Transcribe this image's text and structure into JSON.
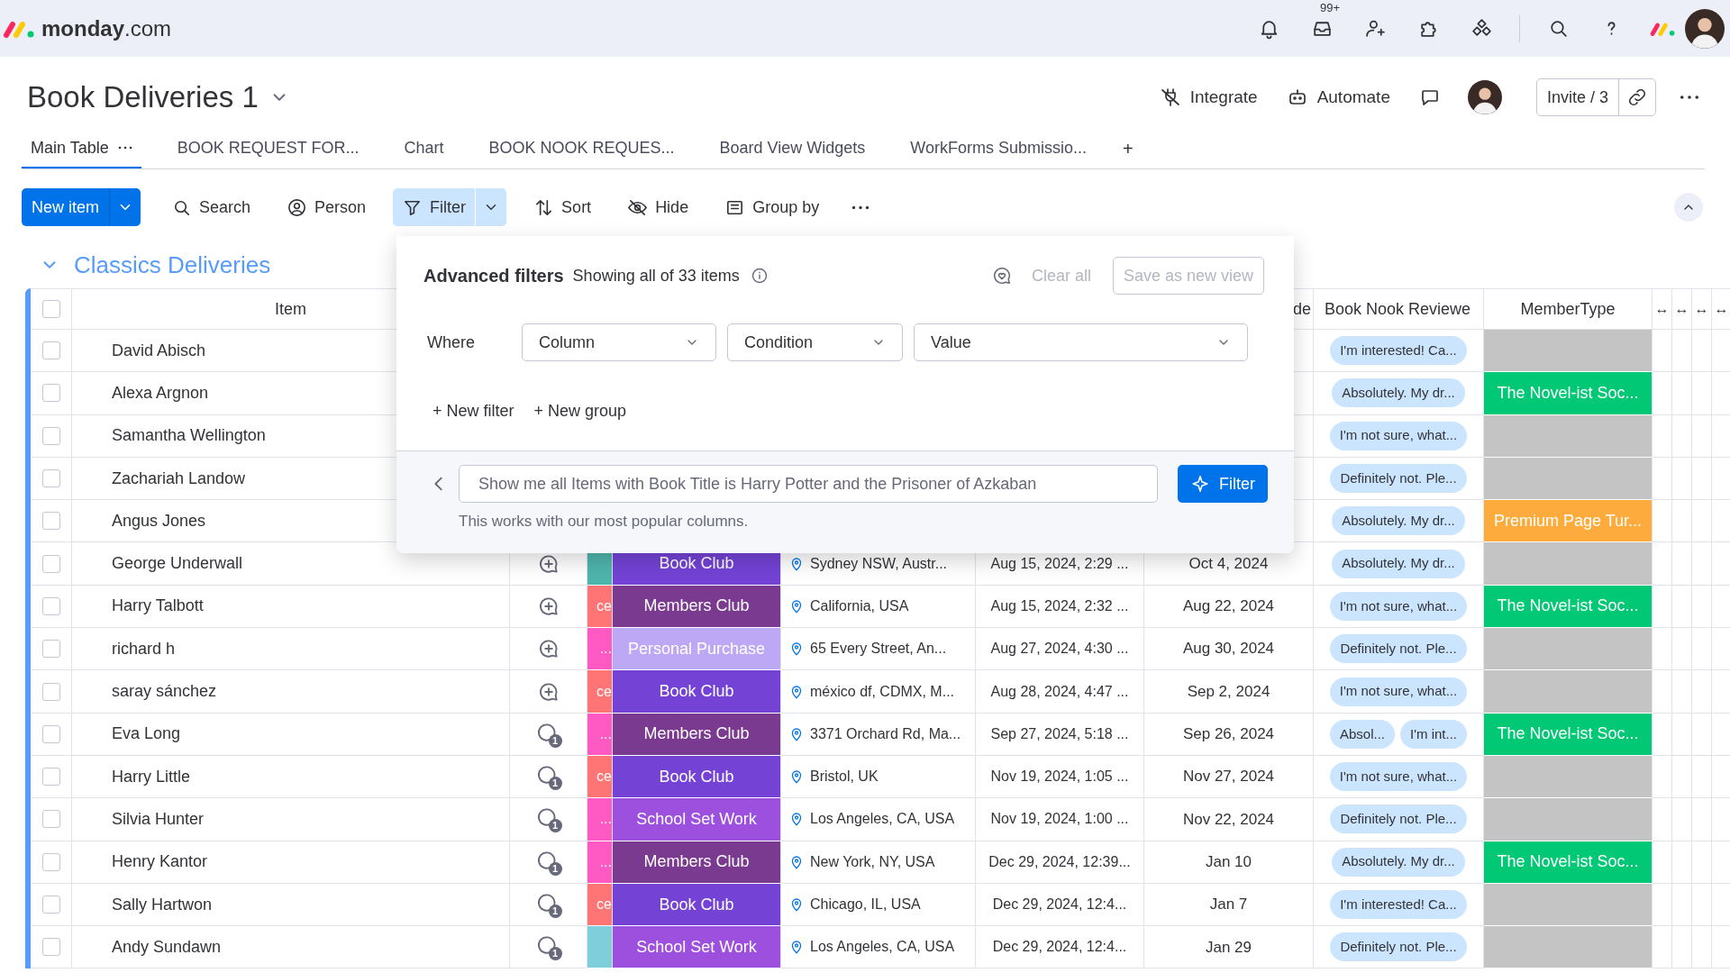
{
  "top_bar": {
    "logo": "**monday**.com",
    "inbox_badge": "99+"
  },
  "board": {
    "title": "Book Deliveries 1",
    "actions": [
      {
        "kind": "integrate",
        "label": "Integrate"
      },
      {
        "kind": "automate",
        "label": "Automate"
      }
    ],
    "invite": "Invite / 3"
  },
  "tabs": [
    {
      "label": "Main Table",
      "selected": true
    },
    {
      "label": "BOOK REQUEST FOR...",
      "selected": false
    },
    {
      "label": "Chart",
      "selected": false
    },
    {
      "label": "BOOK NOOK REQUES...",
      "selected": false
    },
    {
      "label": "Board View Widgets",
      "selected": false
    },
    {
      "label": "WorkForms Submissio...",
      "selected": false
    }
  ],
  "add_tab": "+",
  "toolbar": {
    "new_item": "New item",
    "tools": [
      {
        "kind": "search",
        "label": "Search",
        "selected": false
      },
      {
        "kind": "person",
        "label": "Person",
        "selected": false
      },
      {
        "kind": "filter",
        "label": "Filter",
        "selected": true
      },
      {
        "kind": "sort",
        "label": "Sort",
        "selected": false
      },
      {
        "kind": "hide",
        "label": "Hide",
        "selected": false
      },
      {
        "kind": "group",
        "label": "Group by",
        "selected": false
      }
    ]
  },
  "group": {
    "title": "Classics Deliveries",
    "expanded": true
  },
  "table": {
    "select_all": {
      "checked": false
    },
    "columns": [
      {
        "kind": "item",
        "label": "Item"
      },
      {
        "kind": "due",
        "label": "de"
      },
      {
        "kind": "reviews",
        "label": "Book Nook Reviewe"
      },
      {
        "kind": "member",
        "label": "MemberType"
      },
      {
        "kind": "resize",
        "label": "↔"
      },
      {
        "kind": "resize",
        "label": "↔"
      },
      {
        "kind": "resize",
        "label": "↔"
      },
      {
        "kind": "resize",
        "label": "↔"
      }
    ],
    "rows": [
      {
        "item": "David Abisch",
        "checked": false,
        "reviews": [
          "I'm interested! Ca..."
        ],
        "member": {
          "color": "#c4c4c4"
        }
      },
      {
        "item": "Alexa Argnon",
        "checked": false,
        "reviews": [
          "Absolutely. My dr..."
        ],
        "member": {
          "label": "The Novel-ist Soc...",
          "color": "#00c875"
        }
      },
      {
        "item": "Samantha Wellington",
        "checked": false,
        "reviews": [
          "I'm not sure, what..."
        ],
        "member": {
          "color": "#c4c4c4"
        }
      },
      {
        "item": "Zachariah Landow",
        "checked": false,
        "reviews": [
          "Definitely not. Ple..."
        ],
        "member": {
          "color": "#c4c4c4"
        }
      },
      {
        "item": "Angus Jones",
        "checked": false,
        "reviews": [
          "Absolutely. My dr..."
        ],
        "member": {
          "label": "Premium Page Tur...",
          "color": "#fdab3d"
        }
      },
      {
        "item": "George Underwall",
        "checked": false,
        "chat": {
          "kind": "add"
        },
        "tag": {
          "color": "#4eb5ad"
        },
        "status": {
          "label": "Book Club",
          "color": "#7443d6"
        },
        "location": "Sydney NSW, Austr...",
        "date": "Aug 15, 2024, 2:29 ...",
        "due": "Oct 4, 2024",
        "reviews": [
          "Absolutely. My dr..."
        ],
        "member": {
          "color": "#c4c4c4"
        }
      },
      {
        "item": "Harry Talbott",
        "checked": false,
        "chat": {
          "kind": "add"
        },
        "tag": {
          "text": "ce",
          "color": "#ff7575"
        },
        "status": {
          "label": "Members Club",
          "color": "#7a3a8f"
        },
        "location": "California, USA",
        "date": "Aug 15, 2024, 2:32 ...",
        "due": "Aug 22, 2024",
        "reviews": [
          "I'm not sure, what..."
        ],
        "member": {
          "label": "The Novel-ist Soc...",
          "color": "#00c875"
        }
      },
      {
        "item": "richard h",
        "checked": false,
        "chat": {
          "kind": "add"
        },
        "tag": {
          "text": "...",
          "color": "#ff5ac4"
        },
        "status": {
          "label": "Personal Purchase",
          "color": "#bda8f5"
        },
        "location": "65 Every Street, An...",
        "date": "Aug 27, 2024, 4:30 ...",
        "due": "Aug 30, 2024",
        "reviews": [
          "Definitely not. Ple..."
        ],
        "member": {
          "color": "#c4c4c4"
        }
      },
      {
        "item": "saray sánchez",
        "checked": false,
        "chat": {
          "kind": "add"
        },
        "tag": {
          "text": "ce",
          "color": "#ff7575"
        },
        "status": {
          "label": "Book Club",
          "color": "#7443d6"
        },
        "location": "méxico df, CDMX, M...",
        "date": "Aug 28, 2024, 4:47 ...",
        "due": "Sep 2, 2024",
        "reviews": [
          "I'm not sure, what..."
        ],
        "member": {
          "color": "#c4c4c4"
        }
      },
      {
        "item": "Eva Long",
        "checked": false,
        "chat": {
          "kind": "count",
          "count": "1"
        },
        "tag": {
          "text": "...",
          "color": "#ff5ac4"
        },
        "status": {
          "label": "Members Club",
          "color": "#7a3a8f"
        },
        "location": "3371 Orchard Rd, Ma...",
        "date": "Sep 27, 2024, 5:18 ...",
        "due": "Sep 26, 2024",
        "reviews": [
          "Absol...",
          "I'm int..."
        ],
        "member": {
          "label": "The Novel-ist Soc...",
          "color": "#00c875"
        }
      },
      {
        "item": "Harry Little",
        "checked": false,
        "chat": {
          "kind": "count",
          "count": "1"
        },
        "tag": {
          "text": "ce",
          "color": "#ff7575"
        },
        "status": {
          "label": "Book Club",
          "color": "#7443d6"
        },
        "location": "Bristol, UK",
        "date": "Nov 19, 2024, 1:05 ...",
        "due": "Nov 27, 2024",
        "reviews": [
          "I'm not sure, what..."
        ],
        "member": {
          "color": "#c4c4c4"
        }
      },
      {
        "item": "Silvia Hunter",
        "checked": false,
        "chat": {
          "kind": "count",
          "count": "1"
        },
        "tag": {
          "text": "...",
          "color": "#ff5ac4"
        },
        "status": {
          "label": "School Set Work",
          "color": "#9d50dd"
        },
        "location": "Los Angeles, CA, USA",
        "date": "Nov 19, 2024, 1:00 ...",
        "due": "Nov 22, 2024",
        "reviews": [
          "Definitely not. Ple..."
        ],
        "member": {
          "color": "#c4c4c4"
        }
      },
      {
        "item": "Henry Kantor",
        "checked": false,
        "chat": {
          "kind": "count",
          "count": "1"
        },
        "tag": {
          "text": "...",
          "color": "#ff5ac4"
        },
        "status": {
          "label": "Members Club",
          "color": "#7a3a8f"
        },
        "location": "New York, NY, USA",
        "date": "Dec 29, 2024, 12:39...",
        "due": "Jan 10",
        "reviews": [
          "Absolutely. My dr..."
        ],
        "member": {
          "label": "The Novel-ist Soc...",
          "color": "#00c875"
        }
      },
      {
        "item": "Sally Hartwon",
        "checked": false,
        "chat": {
          "kind": "count",
          "count": "1"
        },
        "tag": {
          "text": "ce",
          "color": "#ff7575"
        },
        "status": {
          "label": "Book Club",
          "color": "#7443d6"
        },
        "location": "Chicago, IL, USA",
        "date": "Dec 29, 2024, 12:4...",
        "due": "Jan 7",
        "reviews": [
          "I'm interested! Ca..."
        ],
        "member": {
          "color": "#c4c4c4"
        }
      },
      {
        "item": "Andy Sundawn",
        "checked": false,
        "chat": {
          "kind": "count",
          "count": "1"
        },
        "tag": {
          "color": "#7ecfdb"
        },
        "status": {
          "label": "School Set Work",
          "color": "#9d50dd"
        },
        "location": "Los Angeles, CA, USA",
        "date": "Dec 29, 2024, 12:4...",
        "due": "Jan 29",
        "reviews": [
          "Definitely not. Ple..."
        ],
        "member": {
          "color": "#c4c4c4"
        }
      }
    ]
  },
  "filter_panel": {
    "title": "Advanced filters",
    "summary": "Showing all of 33 items",
    "clear_all": {
      "label": "Clear all",
      "disabled": true
    },
    "save_view": {
      "label": "Save as new view",
      "disabled": true
    },
    "where": "Where",
    "dropdowns": [
      "Column",
      "Condition",
      "Value"
    ],
    "add_links": [
      "+ New filter",
      "+ New group"
    ],
    "ai_query": {
      "placeholder": "Show me all Items with Book Title is Harry Potter and the Prisoner of Azkaban",
      "button": "Filter",
      "hint": "This works with our most popular columns."
    }
  }
}
